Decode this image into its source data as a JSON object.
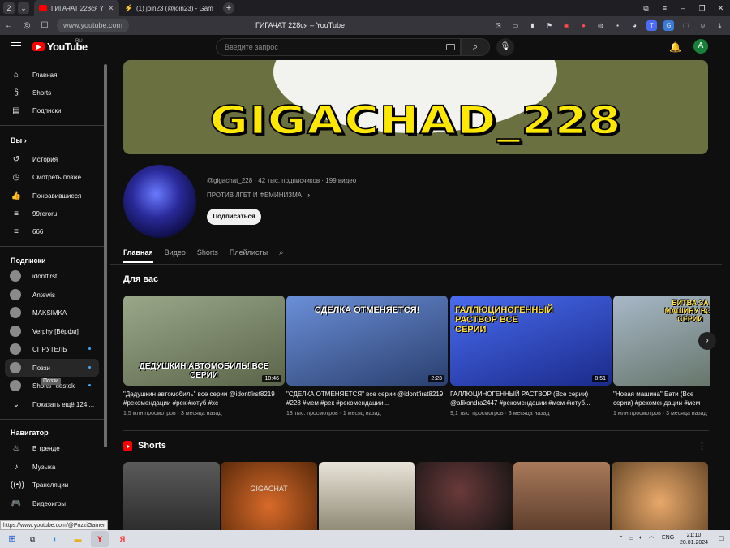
{
  "browser": {
    "tab_counter": "2",
    "tabs": [
      {
        "title": "ГИГАЧАТ 228ся Y"
      },
      {
        "title": "(1) join23 (@join23) - Gam"
      }
    ],
    "url": "www.youtube.com",
    "page_title": "ГИГАЧАТ 228ся – YouTube",
    "status_url": "https://www.youtube.com/@PozziGamer"
  },
  "yt_header": {
    "logo_text": "YouTube",
    "region": "RU",
    "search_placeholder": "Введите запрос",
    "avatar_letter": "A"
  },
  "sidebar": {
    "main": [
      {
        "label": "Главная",
        "icon": "home-icon"
      },
      {
        "label": "Shorts",
        "icon": "shorts-icon"
      },
      {
        "label": "Подписки",
        "icon": "subscriptions-icon"
      }
    ],
    "you_heading": "Вы",
    "you": [
      {
        "label": "История",
        "icon": "history-icon"
      },
      {
        "label": "Смотреть позже",
        "icon": "clock-icon"
      },
      {
        "label": "Понравившиеся",
        "icon": "like-icon"
      },
      {
        "label": "99reroru",
        "icon": "playlist-icon"
      },
      {
        "label": "666",
        "icon": "playlist-icon"
      }
    ],
    "subs_heading": "Подписки",
    "subs": [
      {
        "label": "idontfirst",
        "live": false
      },
      {
        "label": "Antewis",
        "live": false
      },
      {
        "label": "MAKSIMKA",
        "live": false
      },
      {
        "label": "Verphy [Вёрфи]",
        "live": false
      },
      {
        "label": "СПРУТЕЛЬ",
        "live": true
      },
      {
        "label": "Поззи",
        "live": true
      },
      {
        "label": "Shorts Riestok",
        "live": true
      }
    ],
    "show_more": "Показать ещё 124 ...",
    "tooltip": "Поззи",
    "nav_heading": "Навигатор",
    "nav": [
      {
        "label": "В тренде",
        "icon": "fire-icon"
      },
      {
        "label": "Музыка",
        "icon": "music-icon"
      },
      {
        "label": "Трансляции",
        "icon": "live-icon"
      },
      {
        "label": "Видеоигры",
        "icon": "gamepad-icon"
      }
    ]
  },
  "channel": {
    "banner_text": "GIGACHAD_228",
    "handle": "@gigachat_228",
    "stats": "· 42 тыс. подписчиков · 199 видео",
    "description": "ПРОТИВ ЛГБТ И ФЕМИНИЗМА",
    "subscribe_label": "Подписаться",
    "tabs": [
      "Главная",
      "Видео",
      "Shorts",
      "Плейлисты"
    ]
  },
  "for_you": {
    "heading": "Для вас",
    "videos": [
      {
        "thumb_text": "ДЕДУШКИН АВТОМОБИЛЬ! ВСЕ СЕРИИ",
        "duration": "10:46",
        "title": "\"Дедушкин автомобиль\" все серии @idontfirst8219 #рекомендации #рек #ютуб #хс",
        "meta": "1,5 млн просмотров · 3 месяца назад",
        "color": "#6f7a5a"
      },
      {
        "thumb_text": "СДЕЛКА ОТМЕНЯЕТСЯ!",
        "duration": "2:23",
        "title": "\"СДЕЛКА ОТМЕНЯЕТСЯ\" все серии @idontfirst8219 #228 #мем #рек #рекомендации...",
        "meta": "13 тыс. просмотров · 1 месяц назад",
        "color": "#4a6fae"
      },
      {
        "thumb_text": "ГАЛЛЮЦИНОГЕННЫЙ РАСТВОР ВСЕ СЕРИИ",
        "duration": "8:51",
        "title": "ГАЛЛЮЦИНОГЕННЫЙ РАСТВОР (Все серии) @alikondra2447 #рекомендации #мем #ютуб...",
        "meta": "9,1 тыс. просмотров · 3 месяца назад",
        "color": "#3a56c8"
      },
      {
        "thumb_text": "БИТВА ЗА МАШИНУ ВСЕ СЕРИИ",
        "duration": "",
        "title": "\"Новая машина\" Бати (Все серии) #рекомендации #мем #шортс #тренды...",
        "meta": "1 млн просмотров · 3 месяца назад",
        "color": "#7a8a9a"
      }
    ]
  },
  "shorts": {
    "heading": "Shorts",
    "items": [
      {
        "text": "",
        "color": "#4a4a4a"
      },
      {
        "text": "GIGACHAT",
        "color": "#b85a1a"
      },
      {
        "text": "",
        "color": "#c9c4b5"
      },
      {
        "text": "",
        "color": "#1c1c1c"
      },
      {
        "text": "",
        "color": "#8a5a3a"
      },
      {
        "text": "",
        "color": "#c98a4a"
      }
    ]
  },
  "taskbar": {
    "lang": "ENG",
    "time": "21:10",
    "date": "20.01.2024"
  }
}
